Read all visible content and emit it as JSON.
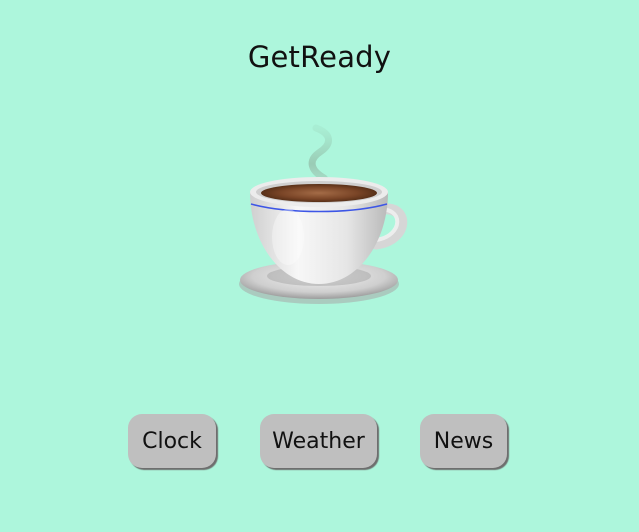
{
  "app": {
    "title": "GetReady",
    "background_color": "#adf6dc"
  },
  "image": {
    "icon": "coffee-cup-icon"
  },
  "buttons": {
    "clock_label": "Clock",
    "weather_label": "Weather",
    "news_label": "News"
  }
}
